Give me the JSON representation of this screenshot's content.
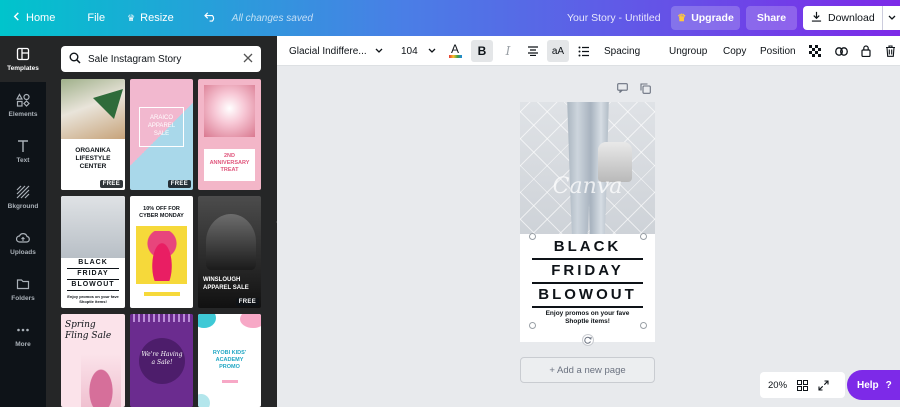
{
  "topbar": {
    "home_label": "Home",
    "file_label": "File",
    "resize_label": "Resize",
    "save_status": "All changes saved",
    "doc_title": "Your Story - Untitled",
    "upgrade_label": "Upgrade",
    "share_label": "Share",
    "download_label": "Download"
  },
  "rail": {
    "items": [
      {
        "label": "Templates",
        "icon": "templates-icon"
      },
      {
        "label": "Elements",
        "icon": "elements-icon"
      },
      {
        "label": "Text",
        "icon": "text-icon"
      },
      {
        "label": "Bkground",
        "icon": "background-icon"
      },
      {
        "label": "Uploads",
        "icon": "uploads-icon"
      },
      {
        "label": "Folders",
        "icon": "folders-icon"
      },
      {
        "label": "More",
        "icon": "more-icon"
      }
    ]
  },
  "search": {
    "value": "Sale Instagram Story"
  },
  "templates": {
    "free_badge": "FREE",
    "t1": {
      "line1": "ORGANIKA",
      "line2": "LIFESTYLE",
      "line3": "CENTER"
    },
    "t2": {
      "line1": "ARAICO",
      "line2": "APPAREL",
      "line3": "SALE"
    },
    "t3": {
      "line1": "2ND",
      "line2": "ANNIVERSARY",
      "line3": "TREAT"
    },
    "t4": {
      "line1": "BLACK",
      "line2": "FRIDAY",
      "line3": "BLOWOUT",
      "sub": "Enjoy promos on your fave Shoptle items!"
    },
    "t5": {
      "line1": "10% OFF FOR",
      "line2": "CYBER MONDAY"
    },
    "t6": {
      "line1": "WINSLOUGH",
      "line2": "APPAREL SALE"
    },
    "t7": {
      "line1": "Spring",
      "line2": "Fling Sale"
    },
    "t8": {
      "line1": "We're Having",
      "line2": "a Sale!"
    },
    "t9": {
      "line1": "RYOBI KIDS'",
      "line2": "ACADEMY",
      "line3": "PROMO"
    }
  },
  "toolbar": {
    "font_name": "Glacial Indiffere...",
    "font_size": "104",
    "spacing_label": "Spacing",
    "ungroup_label": "Ungroup",
    "copy_label": "Copy",
    "position_label": "Position"
  },
  "design": {
    "watermark": "Canva",
    "line1": "BLACK",
    "line2": "FRIDAY",
    "line3": "BLOWOUT",
    "sub1": "Enjoy promos on your fave",
    "sub2": "Shoptle items!"
  },
  "canvas": {
    "add_page_label": "+ Add a new page",
    "zoom_value": "20%",
    "help_label": "Help",
    "help_icon_glyph": "?"
  },
  "colors": {
    "accent_purple": "#7d2ae8",
    "accent_teal": "#00c4cc",
    "panel_dark": "#252627",
    "rail_dark": "#0e1318"
  }
}
